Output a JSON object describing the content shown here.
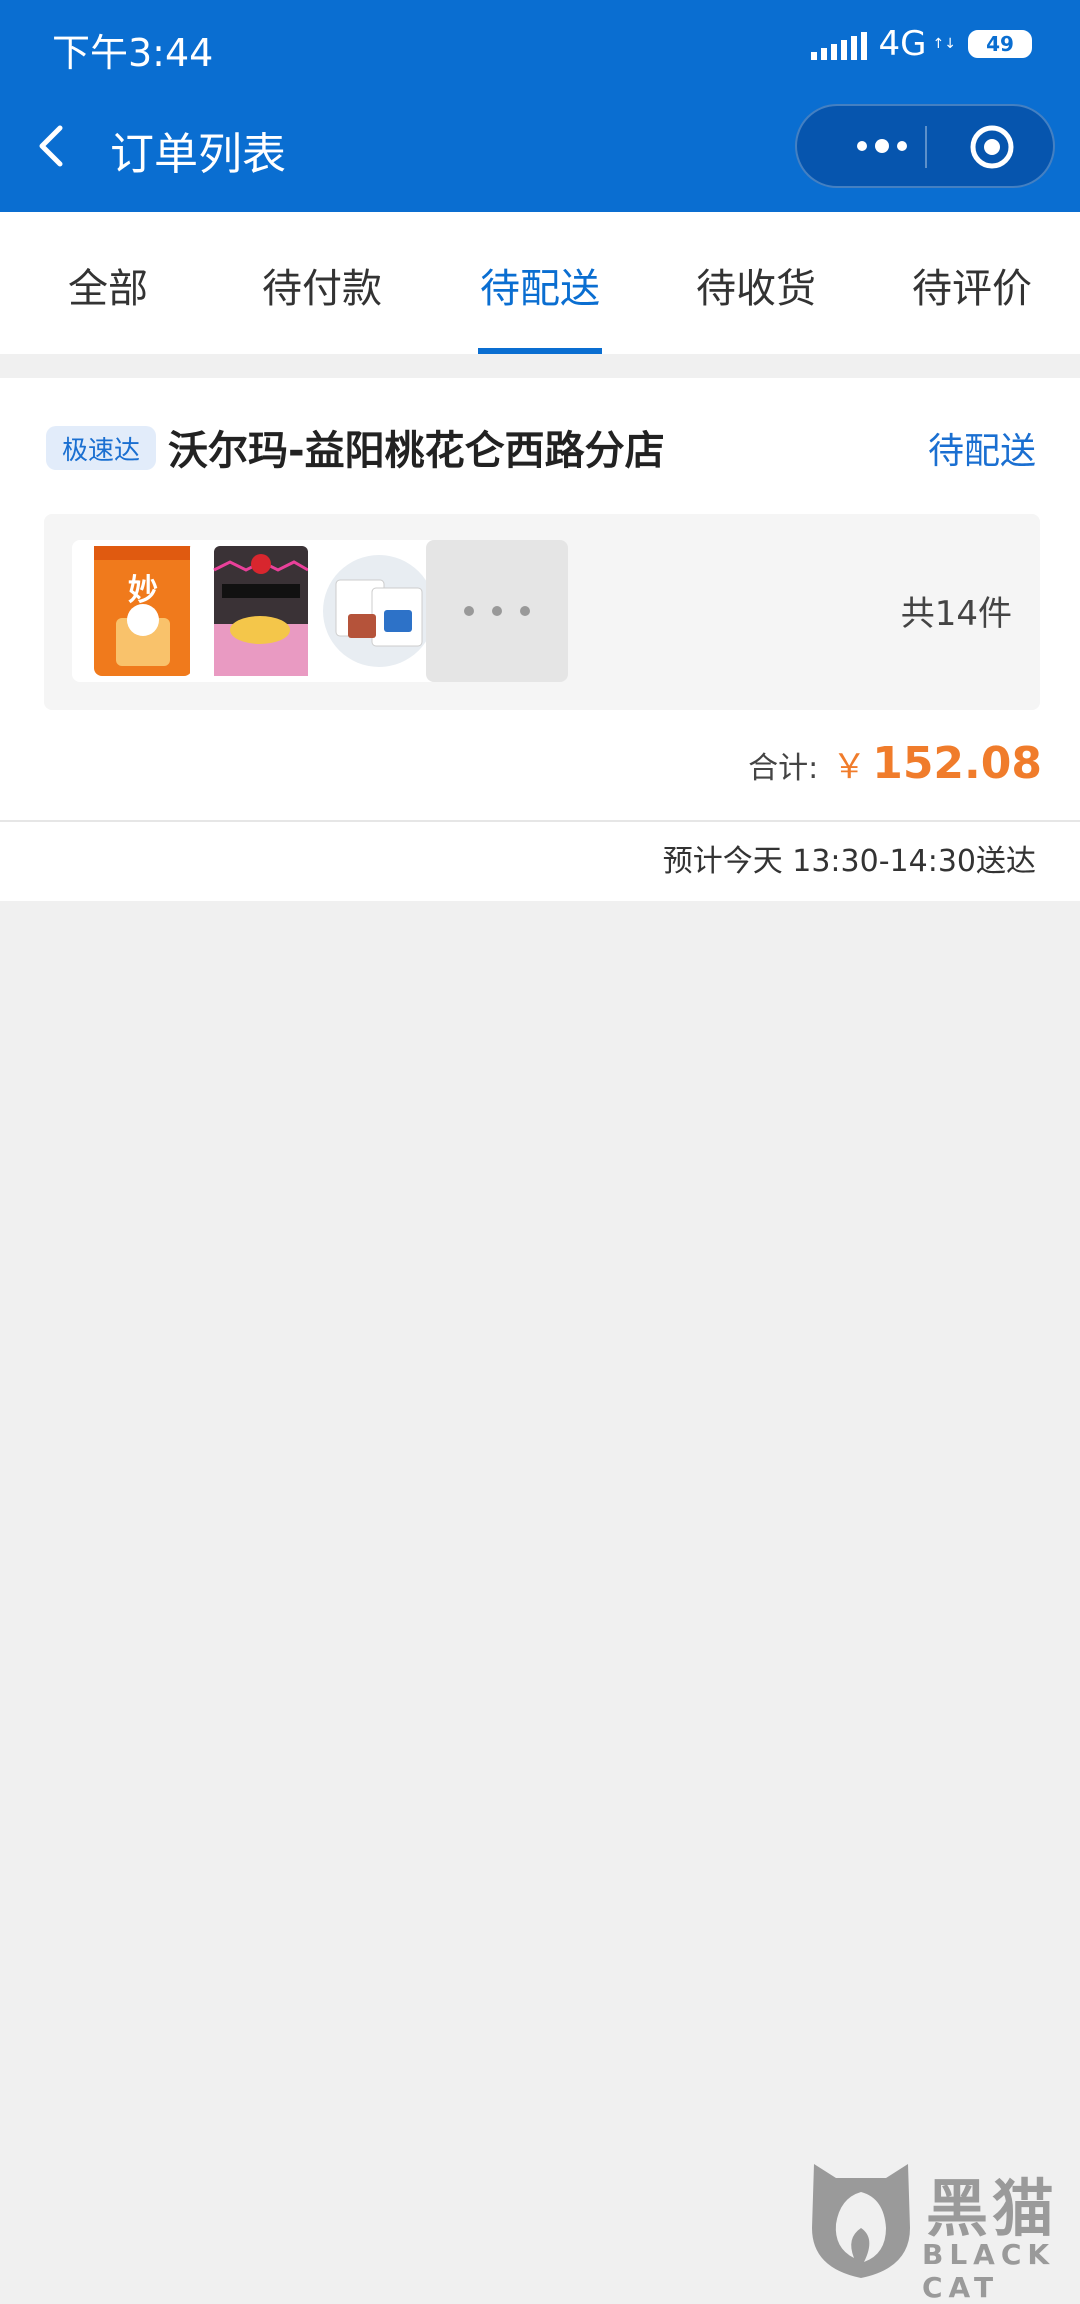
{
  "status_bar": {
    "time": "下午3:44",
    "network": "4G",
    "network_sub": "↑↓",
    "battery": "49"
  },
  "header": {
    "title": "订单列表"
  },
  "tabs": [
    {
      "label": "全部"
    },
    {
      "label": "待付款"
    },
    {
      "label": "待配送",
      "active": true
    },
    {
      "label": "待收货"
    },
    {
      "label": "待评价"
    }
  ],
  "order": {
    "badge": "极速达",
    "store_name": "沃尔玛-益阳桃花仑西路分店",
    "status": "待配送",
    "items": [
      {
        "icon": "cheetos-snack-bag"
      },
      {
        "icon": "lays-chips-bag"
      },
      {
        "icon": "snack-packets-plate"
      }
    ],
    "item_count": "共14件",
    "total_label": "合计:",
    "currency": "￥",
    "total_amount": "152.08",
    "eta": "预计今天 13:30-14:30送达"
  },
  "watermark": {
    "logo_text": "黑猫",
    "sub_text": "BLACK CAT"
  },
  "colors": {
    "primary": "#0a6ed1",
    "price": "#f07c2b",
    "background": "#f0f0f0"
  }
}
